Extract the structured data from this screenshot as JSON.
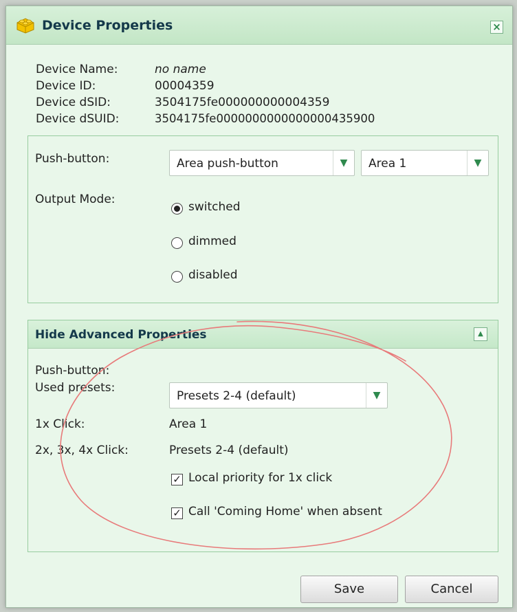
{
  "dialog": {
    "title": "Device Properties",
    "close_symbol": "×"
  },
  "device_info": [
    {
      "label": "Device Name:",
      "value": "no name"
    },
    {
      "label": "Device ID:",
      "value": "00004359"
    },
    {
      "label": "Device dSID:",
      "value": "3504175fe000000000004359"
    },
    {
      "label": "Device dSUID:",
      "value": "3504175fe0000000000000000435900"
    }
  ],
  "basic": {
    "push_button_label": "Push-button:",
    "push_button_type": "Area push-button",
    "push_button_area": "Area 1",
    "output_mode_label": "Output Mode:",
    "output_modes": [
      {
        "label": "switched",
        "checked": true
      },
      {
        "label": "dimmed",
        "checked": false
      },
      {
        "label": "disabled",
        "checked": false
      }
    ]
  },
  "advanced": {
    "header": "Hide Advanced Properties",
    "push_button_label": "Push-button:",
    "used_presets_label": "Used presets:",
    "used_presets_value": "Presets 2-4 (default)",
    "click1_label": "1x Click:",
    "click1_value": "Area 1",
    "click234_label": "2x, 3x, 4x Click:",
    "click234_value": "Presets 2-4 (default)",
    "options": [
      {
        "label": "Local priority for 1x click",
        "checked": true
      },
      {
        "label": "Call 'Coming Home' when absent",
        "checked": true
      }
    ]
  },
  "buttons": {
    "save": "Save",
    "cancel": "Cancel"
  },
  "icons": {
    "title_icon": "lego-brick-icon",
    "dropdown_arrow": "chevron-down-icon",
    "collapse": "chevron-up-icon"
  },
  "colors": {
    "title_text": "#14394a",
    "panel_background": "#e9f7ea",
    "annotation": "#e87a7a"
  }
}
